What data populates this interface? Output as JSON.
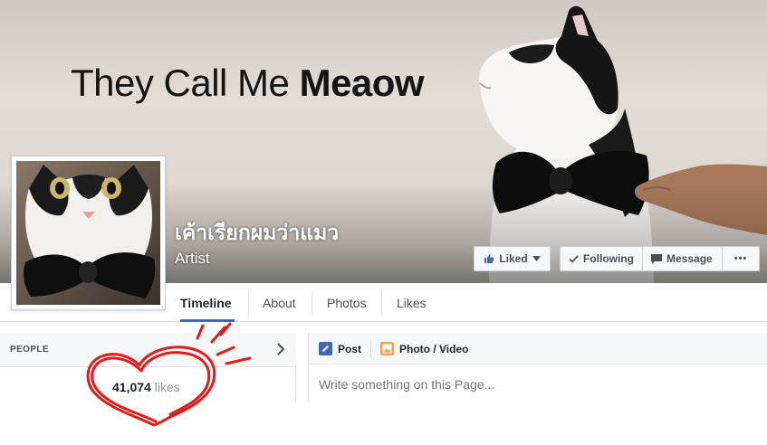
{
  "cover": {
    "headline_regular": "They Call Me",
    "headline_bold": "Meaow"
  },
  "page": {
    "name": "เค้าเรียกผมว่าแมว",
    "category": "Artist"
  },
  "actions": {
    "liked_label": "Liked",
    "following_label": "Following",
    "message_label": "Message",
    "more_label": "•••"
  },
  "tabs": [
    {
      "label": "Timeline",
      "active": true
    },
    {
      "label": "About"
    },
    {
      "label": "Photos"
    },
    {
      "label": "Likes"
    }
  ],
  "people": {
    "title": "PEOPLE",
    "likes_count": "41,074",
    "likes_unit": "likes"
  },
  "composer": {
    "post_label": "Post",
    "photo_label": "Photo / Video",
    "placeholder": "Write something on this Page..."
  },
  "colors": {
    "accent": "#4267b2",
    "doodle": "#e21b1b"
  }
}
